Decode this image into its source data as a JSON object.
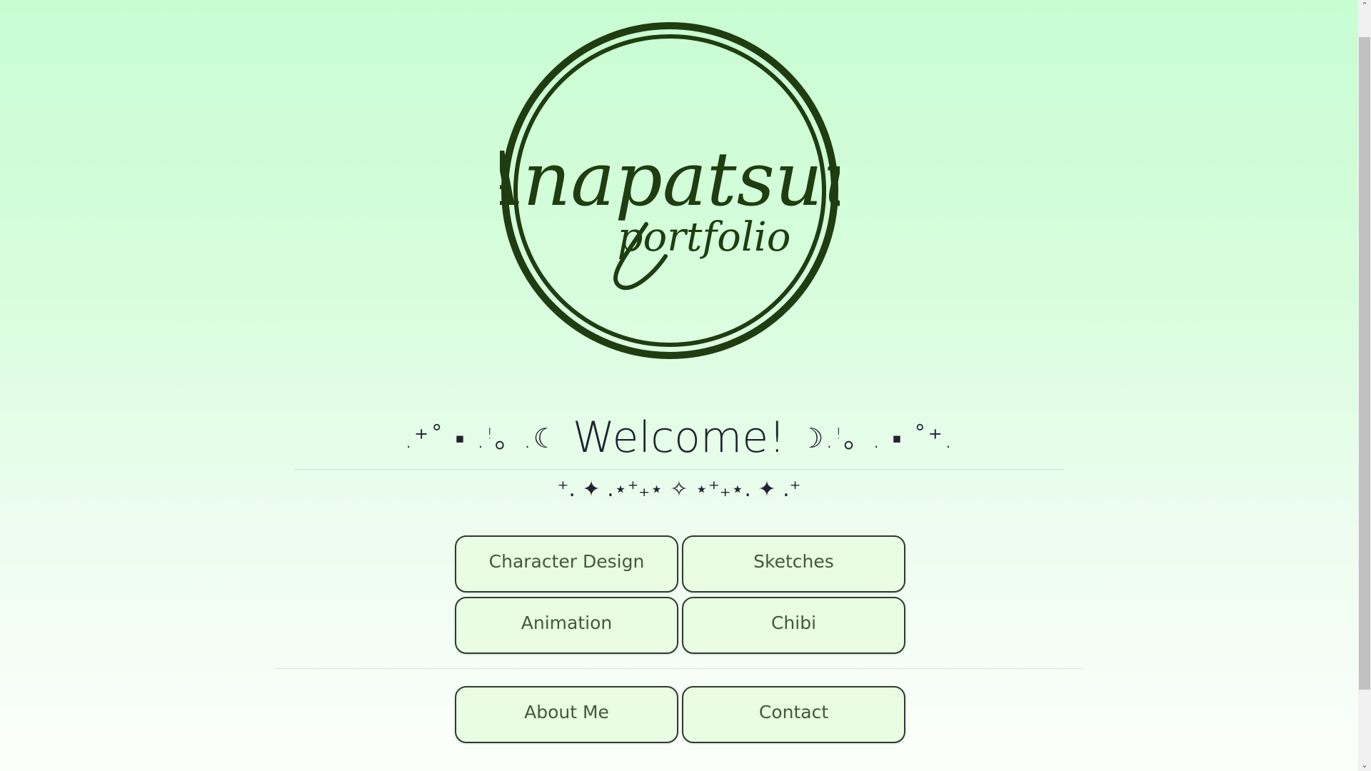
{
  "logo": {
    "main_text": "Anapatsuu",
    "sub_text": "portfolio",
    "colors": {
      "ink": "#1f3d10",
      "fill": "#d3fcd8"
    }
  },
  "welcome": {
    "left_deco": ".⁺˚ ▪ .ꜝ。.☾",
    "title": "Welcome!",
    "right_deco": "☽.ꜝ。. ▪ ˚⁺.",
    "sparkles": "⁺. ✦ .⋆⁺₊⋆ ✧ ⋆⁺₊⋆. ✦ .⁺"
  },
  "nav": {
    "buttons": [
      {
        "label": "Character Design"
      },
      {
        "label": "Sketches"
      },
      {
        "label": "Animation"
      },
      {
        "label": "Chibi"
      }
    ],
    "secondary": [
      {
        "label": "About Me"
      },
      {
        "label": "Contact"
      }
    ]
  },
  "scrollbar": {
    "up_icon": "chevron-up-icon",
    "down_icon": "chevron-down-icon",
    "up_glyph": "⌃",
    "down_glyph": "⌄"
  },
  "theme": {
    "background_top": "#c8fdd2",
    "background_bottom": "#fbfefb",
    "button_fill": "#e8fde2",
    "button_text": "#3f5a3f",
    "button_border": "#2f3b2f"
  }
}
